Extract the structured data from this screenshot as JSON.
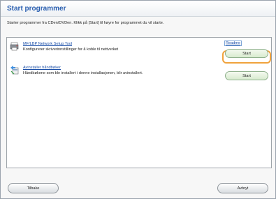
{
  "header": {
    "title": "Start programmer"
  },
  "instruction": "Starter programmer fra CDen/DVDen. Klikk på [Start] til høyre for programmet du vil starte.",
  "programs": [
    {
      "name": "MF/LBP Network Setup Tool",
      "description": "Konfigurerer skriverinnstillinger for å koble til nettverket",
      "readme_label": "Readme",
      "start_label": "Start",
      "icon": "printer-network-icon"
    },
    {
      "name": "Avinstaller håndbøker",
      "description": "Håndbøkene som ble installert i denne installasjonen, blir avinstallert.",
      "start_label": "Start",
      "icon": "uninstall-manuals-icon"
    }
  ],
  "footer": {
    "back_label": "Tilbake",
    "cancel_label": "Avbryt"
  },
  "colors": {
    "title": "#2a5fb0",
    "focus": "#f0a23c",
    "start_button": "#d8ebcf",
    "link": "#1a4ea8"
  }
}
